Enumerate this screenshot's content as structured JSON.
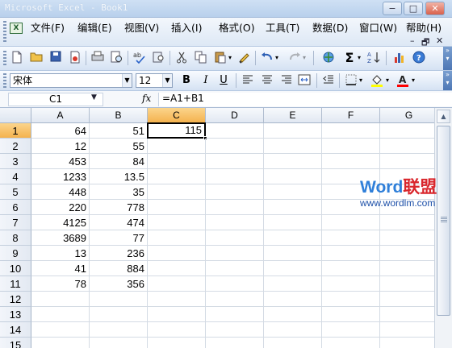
{
  "window": {
    "title": "Microsoft Excel - Book1",
    "min": "−",
    "max": "□",
    "close": "✕"
  },
  "menu": {
    "items": [
      "文件(F)",
      "编辑(E)",
      "视图(V)",
      "插入(I)",
      "格式(O)",
      "工具(T)",
      "数据(D)",
      "窗口(W)",
      "帮助(H)"
    ],
    "doc_controls": [
      "–",
      "🗗",
      "✕"
    ]
  },
  "toolbar": {
    "icons": [
      "new-icon",
      "open-icon",
      "save-icon",
      "permission-icon",
      "print-icon",
      "print-preview-icon",
      "spelling-icon",
      "research-icon",
      "cut-icon",
      "copy-icon",
      "paste-icon",
      "format-painter-icon",
      "undo-icon",
      "redo-icon",
      "hyperlink-icon",
      "autosum-icon",
      "sort-ascending-icon",
      "chart-wizard-icon",
      "help-icon"
    ]
  },
  "format": {
    "font": "宋体",
    "size": "12",
    "bold": "B",
    "italic": "I",
    "underline": "U",
    "fill_color": "#ffff00",
    "font_color": "#ff0000"
  },
  "formula_bar": {
    "name_box": "C1",
    "fx": "fx",
    "formula": "=A1+B1"
  },
  "sheet": {
    "columns": [
      "A",
      "B",
      "C",
      "D",
      "E",
      "F",
      "G"
    ],
    "active_column": "C",
    "active_row": 1,
    "rows": [
      {
        "n": "1",
        "A": "64",
        "B": "51",
        "C": "115"
      },
      {
        "n": "2",
        "A": "12",
        "B": "55",
        "C": ""
      },
      {
        "n": "3",
        "A": "453",
        "B": "84",
        "C": ""
      },
      {
        "n": "4",
        "A": "1233",
        "B": "13.5",
        "C": ""
      },
      {
        "n": "5",
        "A": "448",
        "B": "35",
        "C": ""
      },
      {
        "n": "6",
        "A": "220",
        "B": "778",
        "C": ""
      },
      {
        "n": "7",
        "A": "4125",
        "B": "474",
        "C": ""
      },
      {
        "n": "8",
        "A": "3689",
        "B": "77",
        "C": ""
      },
      {
        "n": "9",
        "A": "13",
        "B": "236",
        "C": ""
      },
      {
        "n": "10",
        "A": "41",
        "B": "884",
        "C": ""
      },
      {
        "n": "11",
        "A": "78",
        "B": "356",
        "C": ""
      },
      {
        "n": "12",
        "A": "",
        "B": "",
        "C": ""
      },
      {
        "n": "13",
        "A": "",
        "B": "",
        "C": ""
      },
      {
        "n": "14",
        "A": "",
        "B": "",
        "C": ""
      },
      {
        "n": "15",
        "A": "",
        "B": "",
        "C": ""
      }
    ]
  },
  "watermark": {
    "word": "Word",
    "zh": "联盟",
    "url": "www.wordlm.com"
  }
}
